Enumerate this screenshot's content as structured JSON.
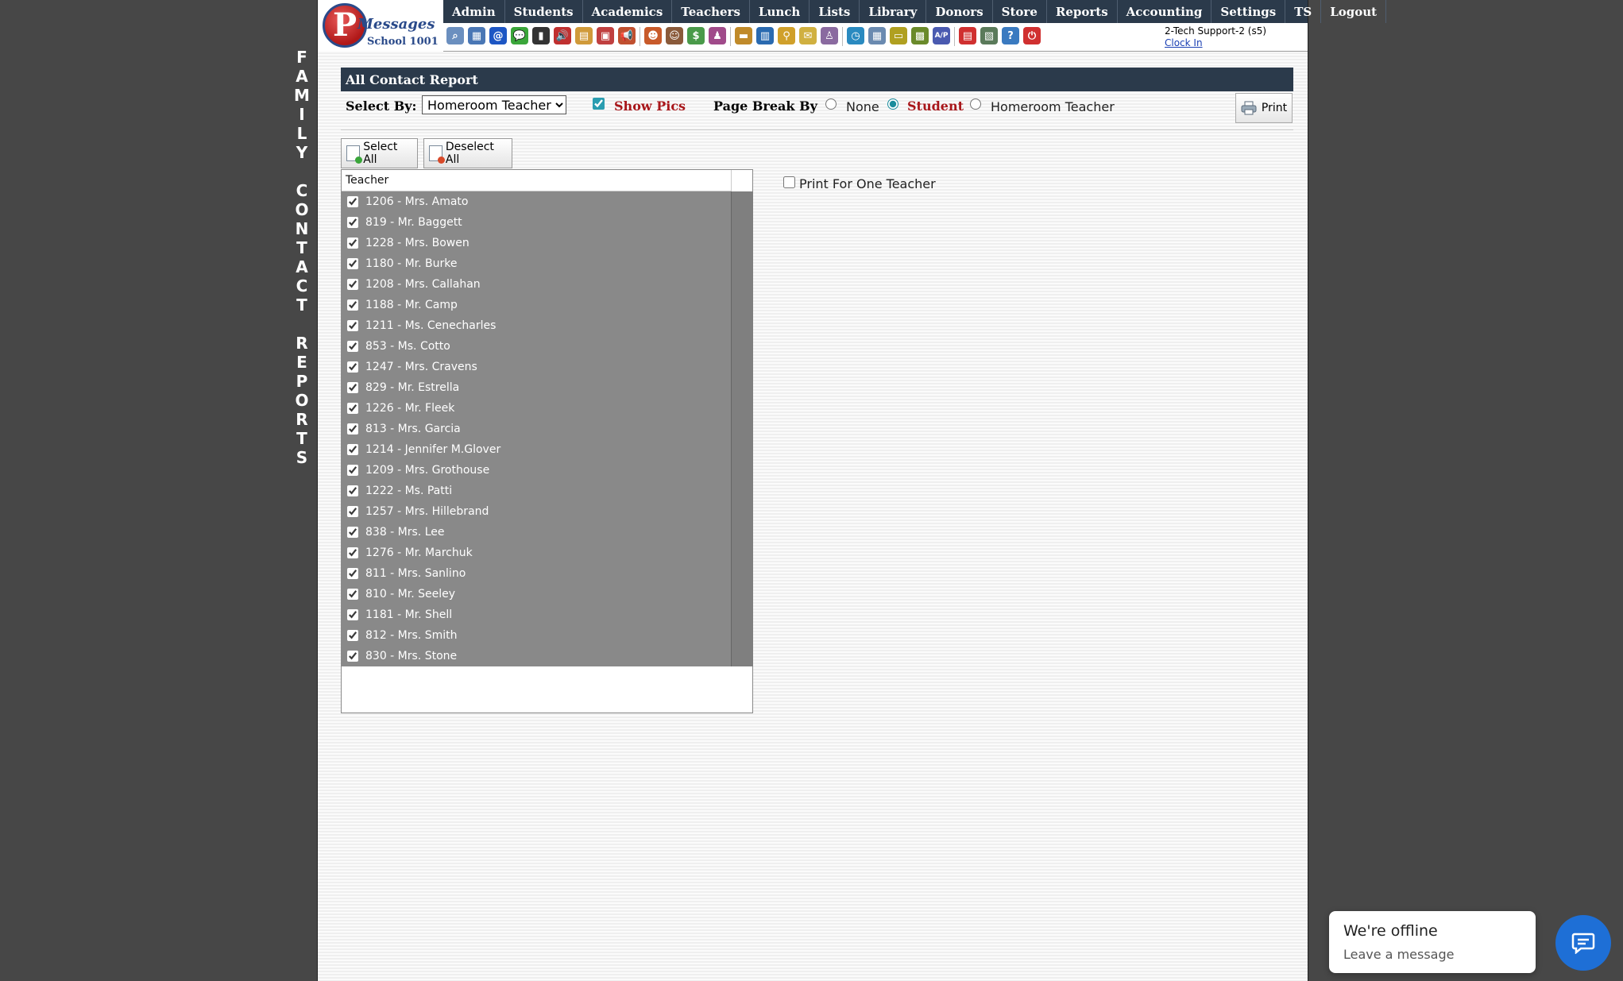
{
  "vertical_title": "FAMILY CONTACT REPORTS",
  "logo": {
    "brand": "Messages",
    "school": "School 1001"
  },
  "nav": [
    "Admin",
    "Students",
    "Academics",
    "Teachers",
    "Lunch",
    "Lists",
    "Library",
    "Donors",
    "Store",
    "Reports",
    "Accounting",
    "Settings",
    "TS",
    "Logout"
  ],
  "toolbar_icons": [
    {
      "name": "search-icon",
      "color": "#6b8fbf",
      "glyph": "⌕"
    },
    {
      "name": "calendar-grid-icon",
      "color": "#4a77b5",
      "glyph": "▦"
    },
    {
      "name": "email-at-icon",
      "color": "#1d56c4",
      "glyph": "@"
    },
    {
      "name": "chat-icon",
      "color": "#3aa63a",
      "glyph": "💬"
    },
    {
      "name": "mobile-phone-icon",
      "color": "#333333",
      "glyph": "▮"
    },
    {
      "name": "speaker-icon",
      "color": "#c03030",
      "glyph": "🔊"
    },
    {
      "name": "notepad-icon",
      "color": "#d09a3a",
      "glyph": "▤"
    },
    {
      "name": "calendar-icon",
      "color": "#c04040",
      "glyph": "▣"
    },
    {
      "name": "megaphone-icon",
      "color": "#c05030",
      "glyph": "📢"
    },
    {
      "name": "student-icon",
      "color": "#c85a2a",
      "glyph": "☻"
    },
    {
      "name": "teacher-icon",
      "color": "#8a5a3a",
      "glyph": "☺"
    },
    {
      "name": "money-icon",
      "color": "#4a9a4a",
      "glyph": "$"
    },
    {
      "name": "family-icon",
      "color": "#a04a8a",
      "glyph": "♟"
    },
    {
      "name": "lunch-icon",
      "color": "#c08a2a",
      "glyph": "▬"
    },
    {
      "name": "book-icon",
      "color": "#2a6ab0",
      "glyph": "▥"
    },
    {
      "name": "broom-icon",
      "color": "#d0a02a",
      "glyph": "⚲"
    },
    {
      "name": "envelope-icon",
      "color": "#d0b040",
      "glyph": "✉"
    },
    {
      "name": "users-icon",
      "color": "#8a6aa0",
      "glyph": "♙"
    },
    {
      "name": "clock-icon",
      "color": "#2a8ac0",
      "glyph": "◷"
    },
    {
      "name": "table-icon",
      "color": "#6a8ab0",
      "glyph": "▦"
    },
    {
      "name": "ticket-icon",
      "color": "#b0a020",
      "glyph": "▭"
    },
    {
      "name": "cash-register-icon",
      "color": "#6a8a2a",
      "glyph": "▩"
    },
    {
      "name": "ap-icon",
      "color": "#4a5ab0",
      "glyph": "A/P"
    },
    {
      "name": "pdf-icon",
      "color": "#d03030",
      "glyph": "▤"
    },
    {
      "name": "money-stack-icon",
      "color": "#5a7a5a",
      "glyph": "▧"
    },
    {
      "name": "help-icon",
      "color": "#3a7ac0",
      "glyph": "?"
    },
    {
      "name": "power-icon",
      "color": "#d03030",
      "glyph": "⏻"
    }
  ],
  "user": {
    "name": "2-Tech Support-2 (s5)",
    "clock_in": "Clock In"
  },
  "report": {
    "title": "All Contact Report",
    "select_by_label": "Select By:",
    "select_by_value": "Homeroom Teacher",
    "show_pics_label": "Show Pics",
    "show_pics_checked": true,
    "page_break_label": "Page Break By",
    "page_break_options": [
      "None",
      "Student",
      "Homeroom Teacher"
    ],
    "page_break_selected": "Student",
    "print_label": "Print"
  },
  "buttons": {
    "select_all": "Select All",
    "deselect_all": "Deselect All"
  },
  "teacher_list": {
    "header": "Teacher",
    "items": [
      "1206 - Mrs. Amato",
      "819 - Mr. Baggett",
      "1228 - Mrs. Bowen",
      "1180 - Mr. Burke",
      "1208 - Mrs. Callahan",
      "1188 - Mr. Camp",
      "1211 - Ms. Cenecharles",
      "853 - Ms. Cotto",
      "1247 - Mrs. Cravens",
      "829 - Mr. Estrella",
      "1226 - Mr. Fleek",
      "813 - Mrs. Garcia",
      "1214 - Jennifer M.Glover",
      "1209 - Mrs. Grothouse",
      "1222 - Ms. Patti",
      "1257 - Mrs. Hillebrand",
      "838 - Mrs. Lee",
      "1276 - Mr. Marchuk",
      "811 - Mrs. Sanlino",
      "810 - Mr. Seeley",
      "1181 - Mr. Shell",
      "812 - Mrs. Smith",
      "830 - Mrs. Stone"
    ]
  },
  "print_one_teacher_label": "Print For One Teacher",
  "chat": {
    "title": "We're offline",
    "subtitle": "Leave a message"
  }
}
